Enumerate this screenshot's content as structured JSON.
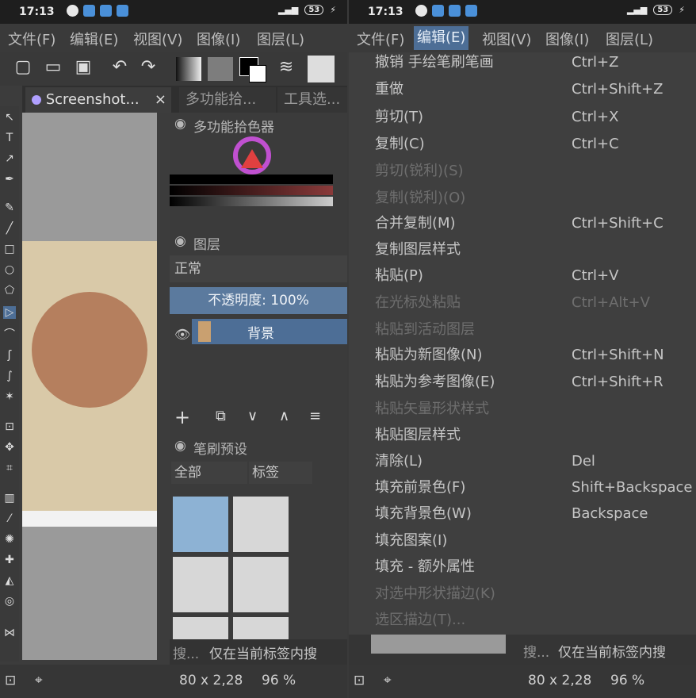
{
  "status": {
    "time": "17:13",
    "battery": "53"
  },
  "menubar": {
    "file": "文件(F)",
    "edit": "编辑(E)",
    "view": "视图(V)",
    "image": "图像(I)",
    "layer": "图层(L)"
  },
  "doc_tab": {
    "title": "Screenshot...",
    "close": "×"
  },
  "dock_tabs": {
    "multi": "多功能拾...",
    "tools": "工具选..."
  },
  "color_picker": {
    "title": "多功能拾色器"
  },
  "layers": {
    "title": "图层",
    "blend_mode": "正常",
    "opacity": "不透明度: 100%",
    "layer_name": "背景"
  },
  "brush_presets": {
    "title": "笔刷预设",
    "filter": "全部",
    "tag": "标签"
  },
  "search": {
    "placeholder": "搜...",
    "only_tag": "仅在当前标签内搜"
  },
  "bottom": {
    "size": "80 x 2,28",
    "zoom": "96 %"
  },
  "edit_menu": [
    {
      "label": "撤销 手绘笔刷笔画",
      "shortcut": "Ctrl+Z",
      "enabled": true
    },
    {
      "label": "重做",
      "shortcut": "Ctrl+Shift+Z",
      "enabled": true
    },
    {
      "label": "剪切(T)",
      "shortcut": "Ctrl+X",
      "enabled": true
    },
    {
      "label": "复制(C)",
      "shortcut": "Ctrl+C",
      "enabled": true
    },
    {
      "label": "剪切(锐利)(S)",
      "shortcut": "",
      "enabled": false
    },
    {
      "label": "复制(锐利)(O)",
      "shortcut": "",
      "enabled": false
    },
    {
      "label": "合并复制(M)",
      "shortcut": "Ctrl+Shift+C",
      "enabled": true
    },
    {
      "label": "复制图层样式",
      "shortcut": "",
      "enabled": true
    },
    {
      "label": "粘贴(P)",
      "shortcut": "Ctrl+V",
      "enabled": true
    },
    {
      "label": "在光标处粘贴",
      "shortcut": "Ctrl+Alt+V",
      "enabled": false
    },
    {
      "label": "粘贴到活动图层",
      "shortcut": "",
      "enabled": false
    },
    {
      "label": "粘贴为新图像(N)",
      "shortcut": "Ctrl+Shift+N",
      "enabled": true
    },
    {
      "label": "粘贴为参考图像(E)",
      "shortcut": "Ctrl+Shift+R",
      "enabled": true
    },
    {
      "label": "粘贴矢量形状样式",
      "shortcut": "",
      "enabled": false
    },
    {
      "label": "粘贴图层样式",
      "shortcut": "",
      "enabled": true
    },
    {
      "label": "清除(L)",
      "shortcut": "Del",
      "enabled": true
    },
    {
      "label": "填充前景色(F)",
      "shortcut": "Shift+Backspace",
      "enabled": true
    },
    {
      "label": "填充背景色(W)",
      "shortcut": "Backspace",
      "enabled": true
    },
    {
      "label": "填充图案(I)",
      "shortcut": "",
      "enabled": true
    },
    {
      "label": "填充 - 额外属性",
      "shortcut": "",
      "enabled": true
    },
    {
      "label": "对选中形状描边(K)",
      "shortcut": "",
      "enabled": false
    },
    {
      "label": "选区描边(T)...",
      "shortcut": "",
      "enabled": false
    }
  ],
  "colors": {
    "accent": "#4d6e96",
    "panel": "#3c3c3c",
    "menu_bg": "#3f3f3f"
  }
}
